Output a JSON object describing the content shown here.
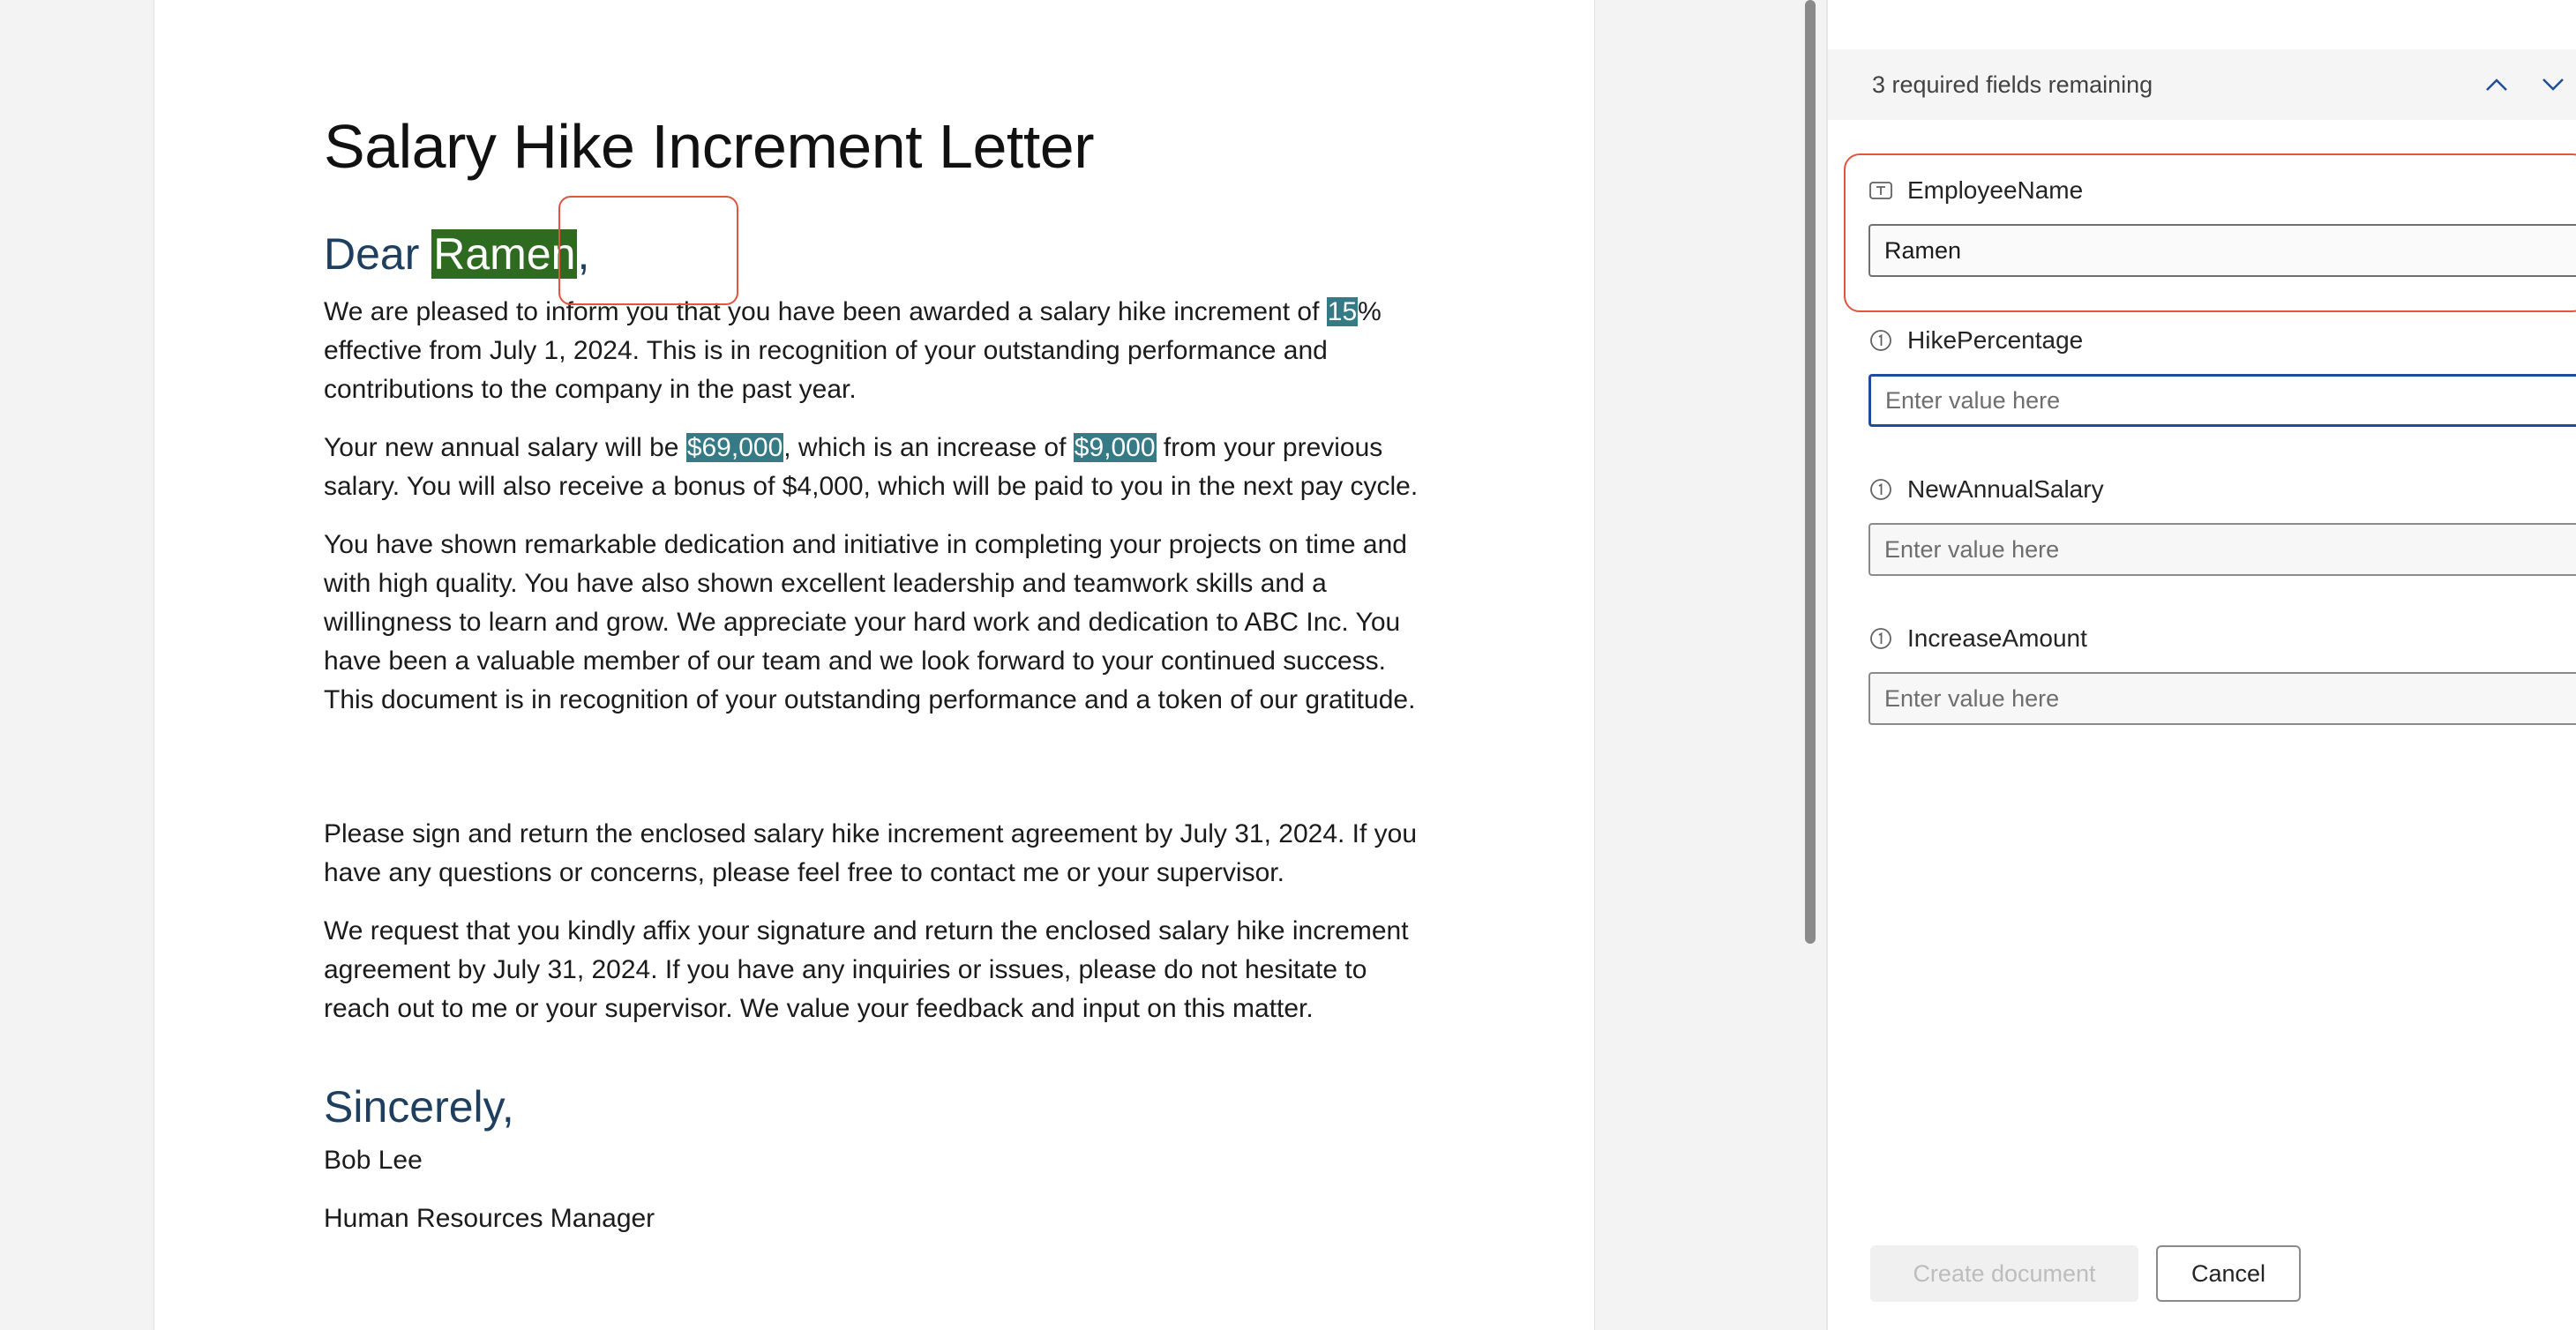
{
  "document": {
    "title": "Salary Hike Increment Letter",
    "greeting_prefix": "Dear ",
    "employee_name": "Ramen",
    "greeting_suffix": ",",
    "p1": {
      "a": "We are pleased to inform you that you have been awarded a salary hike increment of ",
      "hike_value": "15",
      "b": "% effective from July 1, 2024. This is in recognition of your outstanding performance and contributions to the company in the past year."
    },
    "p2": {
      "a": "Your new annual salary will be ",
      "new_salary": "$69,000",
      "b": ", which is an increase of ",
      "increase": "$9,000",
      "c": " from your previous salary. You will also receive a bonus of $4,000, which will be paid to you in the next pay cycle."
    },
    "p3": "You have shown remarkable dedication and initiative in completing your projects on time and with high quality. You have also shown excellent leadership and teamwork skills and a willingness to learn and grow. We appreciate your hard work and dedication to ABC Inc. You have been a valuable member of our team and we look forward to your continued success. This document is in recognition of your outstanding performance and a token of our gratitude.",
    "p4": "Please sign and return the enclosed salary hike increment agreement by July 31, 2024. If you have any questions or concerns, please feel free to contact me or your supervisor.",
    "p5": "We request that you kindly affix your signature and return the enclosed salary hike increment agreement by July 31, 2024. If you have any inquiries or issues, please do not hesitate to reach out to me or your supervisor. We value your feedback and input on this matter.",
    "closing": "Sincerely,",
    "signer_name": "Bob Lee",
    "signer_title": "Human Resources Manager"
  },
  "panel": {
    "remaining": "3 required fields remaining",
    "fields": [
      {
        "label": "EmployeeName",
        "value": "Ramen",
        "placeholder": "Enter value here",
        "icon": "text-field-icon"
      },
      {
        "label": "HikePercentage",
        "value": "",
        "placeholder": "Enter value here",
        "icon": "info-circle-icon"
      },
      {
        "label": "NewAnnualSalary",
        "value": "",
        "placeholder": "Enter value here",
        "icon": "info-circle-icon"
      },
      {
        "label": "IncreaseAmount",
        "value": "",
        "placeholder": "Enter value here",
        "icon": "info-circle-icon"
      }
    ],
    "create_label": "Create document",
    "cancel_label": "Cancel"
  },
  "colors": {
    "name_highlight": "#2e6b20",
    "value_highlight": "#367a86",
    "focus_outline": "#e0553e",
    "active_input_border": "#1f4e99"
  }
}
